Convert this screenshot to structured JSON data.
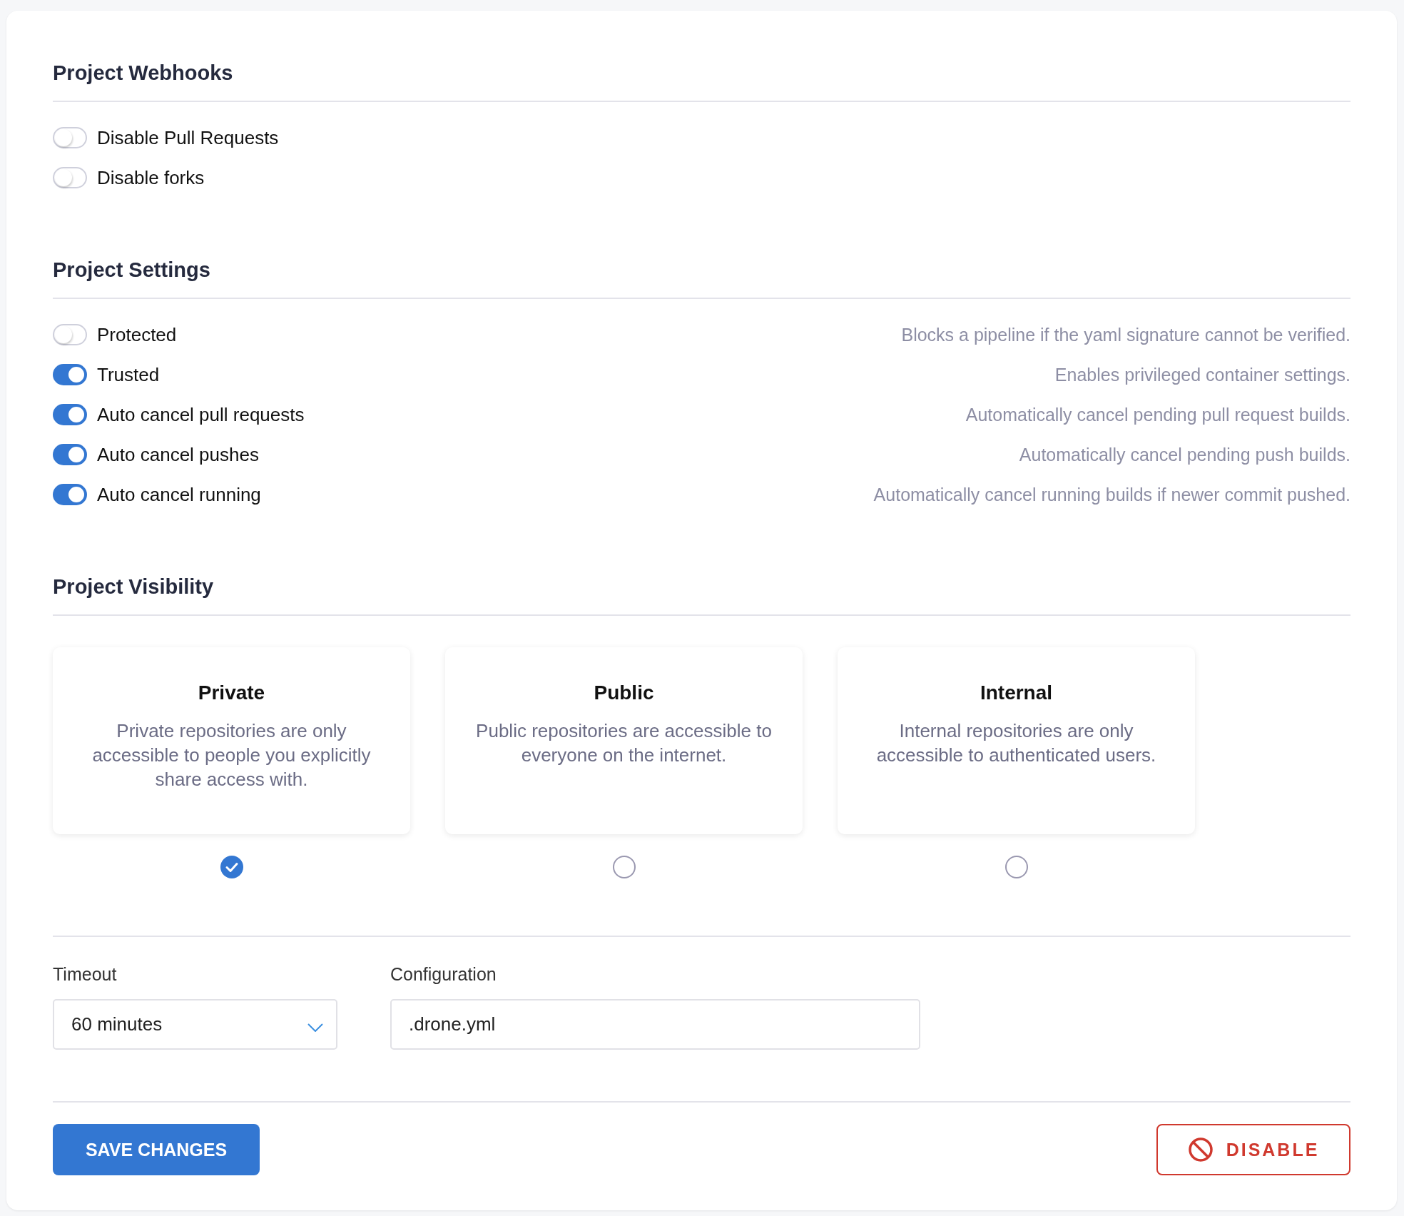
{
  "sections": [
    {
      "title": "Project Webhooks",
      "toggles": [
        {
          "label": "Disable Pull Requests",
          "on": false
        },
        {
          "label": "Disable forks",
          "on": false
        }
      ]
    },
    {
      "title": "Project Settings",
      "toggles": [
        {
          "label": "Protected",
          "on": false,
          "description": "Blocks a pipeline if the yaml signature cannot be verified."
        },
        {
          "label": "Trusted",
          "on": true,
          "description": "Enables privileged container settings."
        },
        {
          "label": "Auto cancel pull requests",
          "on": true,
          "description": "Automatically cancel pending pull request builds."
        },
        {
          "label": "Auto cancel pushes",
          "on": true,
          "description": "Automatically cancel pending push builds."
        },
        {
          "label": "Auto cancel running",
          "on": true,
          "description": "Automatically cancel running builds if newer commit pushed."
        }
      ]
    }
  ],
  "visibility": {
    "title": "Project Visibility",
    "options": [
      {
        "title": "Private",
        "description": "Private repositories are only accessible to people you explicitly share access with.",
        "selected": true
      },
      {
        "title": "Public",
        "description": "Public repositories are accessible to everyone on the internet.",
        "selected": false
      },
      {
        "title": "Internal",
        "description": "Internal repositories are only accessible to authenticated users.",
        "selected": false
      }
    ]
  },
  "timeout": {
    "label": "Timeout",
    "value": "60 minutes"
  },
  "configuration": {
    "label": "Configuration",
    "value": ".drone.yml"
  },
  "buttons": {
    "save": "SAVE CHANGES",
    "disable": "DISABLE"
  }
}
